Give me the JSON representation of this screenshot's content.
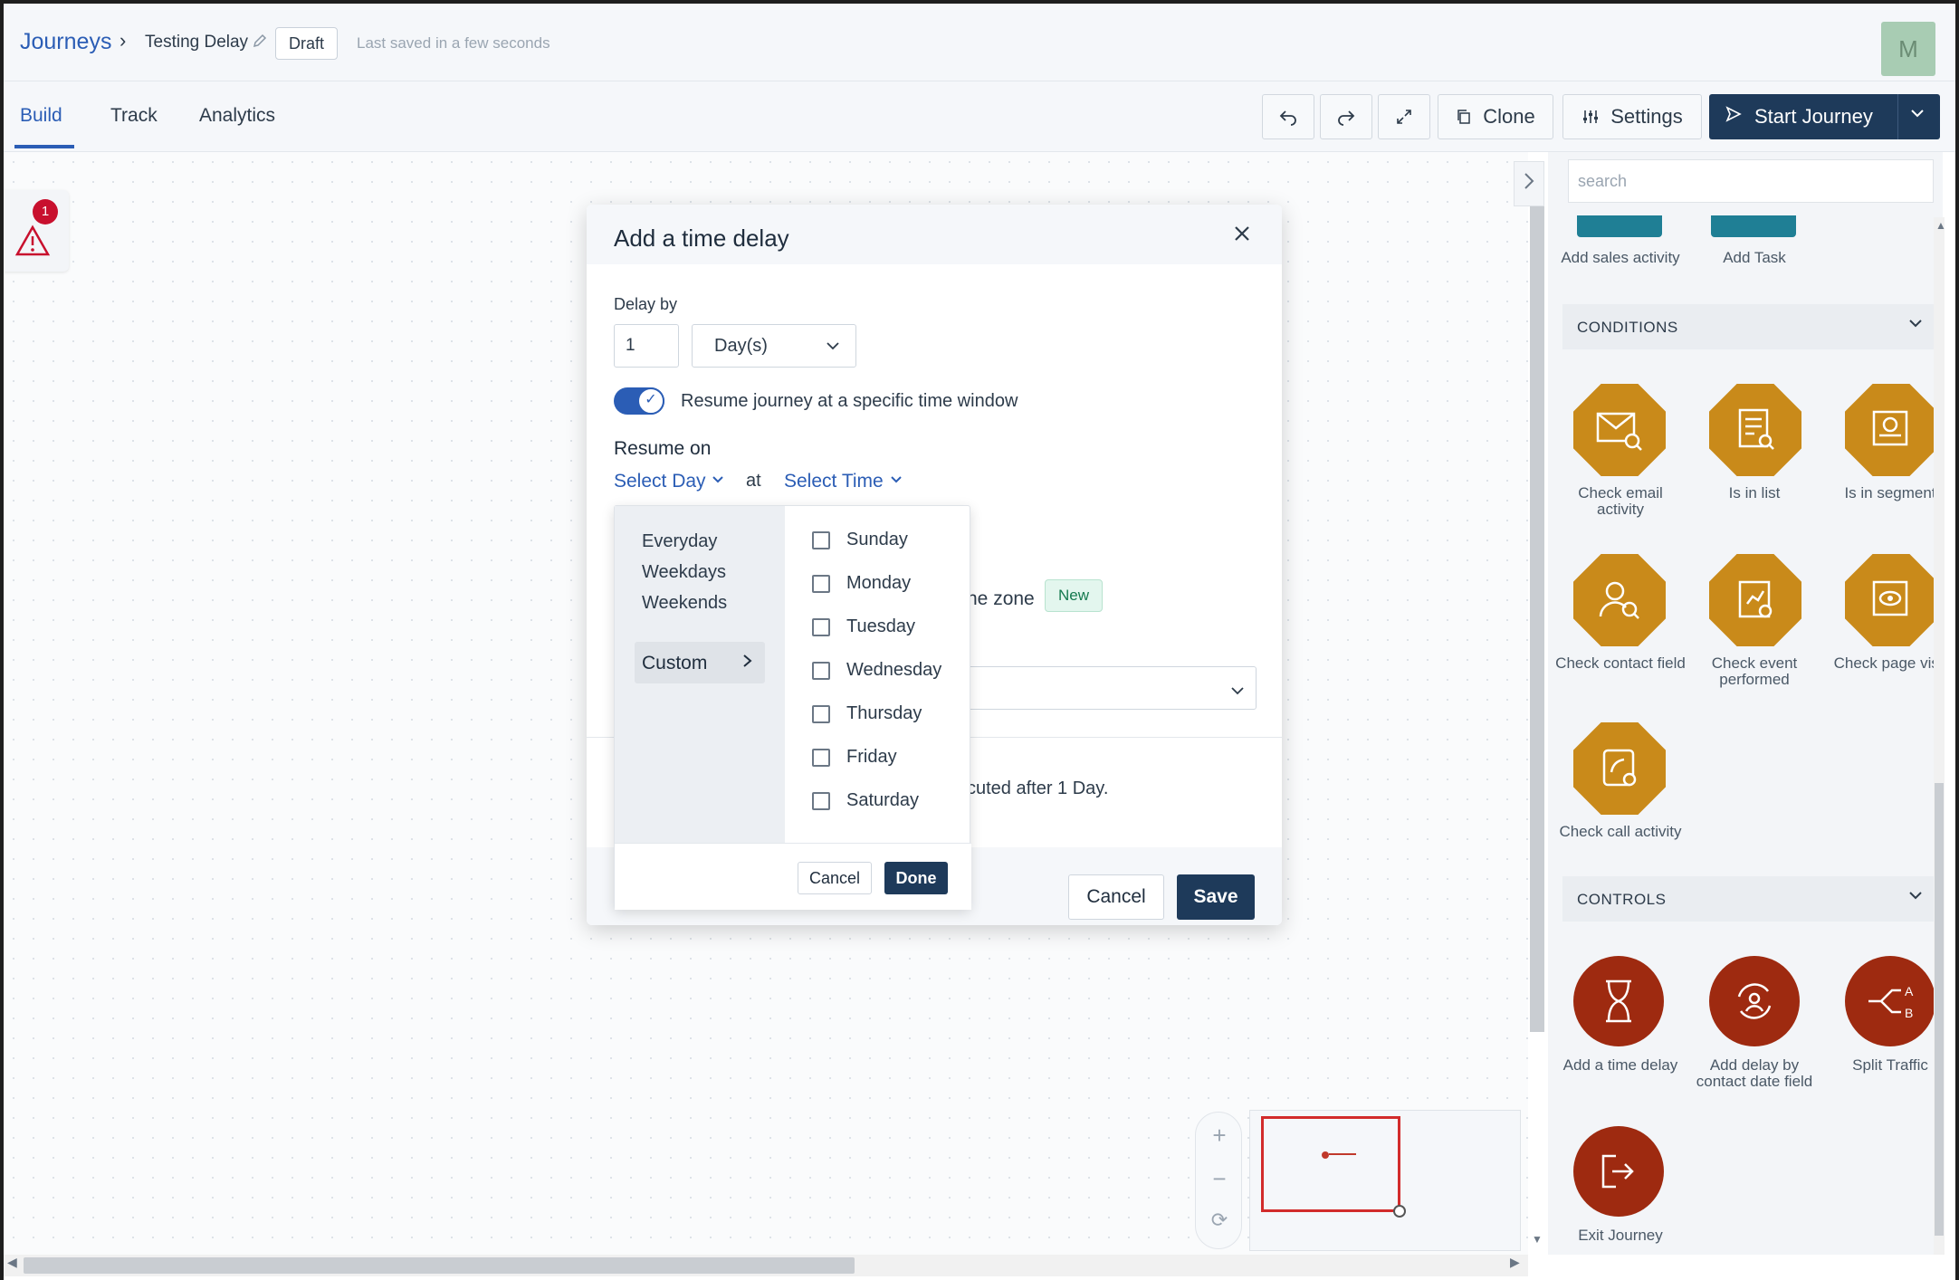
{
  "breadcrumb": {
    "root": "Journeys",
    "separator": "›",
    "journey_name": "Testing Delay",
    "status": "Draft",
    "saved": "Last saved in a few seconds"
  },
  "user": {
    "initial": "M"
  },
  "tabs": [
    {
      "label": "Build",
      "active": true
    },
    {
      "label": "Track"
    },
    {
      "label": "Analytics"
    }
  ],
  "toolbar": {
    "clone": "Clone",
    "settings": "Settings",
    "start": "Start Journey"
  },
  "warnings": {
    "count": "1"
  },
  "panel": {
    "search_placeholder": "search",
    "actions": [
      {
        "label": "Add sales activity"
      },
      {
        "label": "Add Task"
      }
    ],
    "conditions_title": "CONDITIONS",
    "conditions": [
      {
        "label": "Check email activity"
      },
      {
        "label": "Is in list"
      },
      {
        "label": "Is in segment"
      },
      {
        "label": "Check contact field"
      },
      {
        "label": "Check event performed"
      },
      {
        "label": "Check page visit"
      },
      {
        "label": "Check call activity"
      }
    ],
    "controls_title": "CONTROLS",
    "controls": [
      {
        "label": "Add a time delay"
      },
      {
        "label": "Add delay by contact date field"
      },
      {
        "label": "Split Traffic"
      },
      {
        "label": "Exit Journey"
      }
    ],
    "colors": {
      "condition": "#c98a1a",
      "control": "#9e2a10",
      "action": "#1f7f95"
    }
  },
  "modal": {
    "title": "Add a time delay",
    "delay_by_label": "Delay by",
    "delay_value": "1",
    "delay_unit": "Day(s)",
    "toggle_label": "Resume journey at a specific time window",
    "toggle_on": true,
    "resume_on_label": "Resume on",
    "select_day": "Select Day",
    "at": "at",
    "select_time": "Select Time",
    "timezone_partial": "ne zone",
    "new_badge": "New",
    "summary_partial": "cuted after 1 Day.",
    "cancel": "Cancel",
    "save": "Save"
  },
  "day_dropdown": {
    "presets": [
      "Everyday",
      "Weekdays",
      "Weekends"
    ],
    "custom": "Custom",
    "days": [
      "Sunday",
      "Monday",
      "Tuesday",
      "Wednesday",
      "Thursday",
      "Friday",
      "Saturday"
    ],
    "cancel": "Cancel",
    "done": "Done"
  }
}
